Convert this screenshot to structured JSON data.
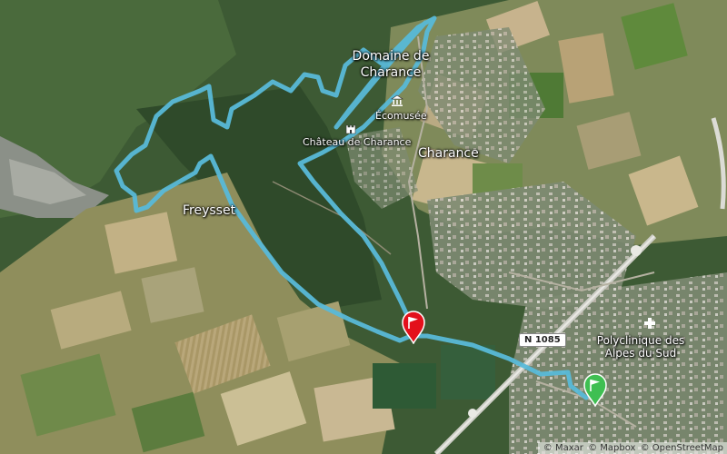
{
  "map": {
    "labels": {
      "domaine": "Domaine de Charance",
      "ecomusee": "Écomusée",
      "chateau": "Château de Charance",
      "charance": "Charance",
      "freysset": "Freysset",
      "polyclinique": "Polyclinique des Alpes du Sud",
      "road": "N 1085"
    },
    "icons": {
      "start": "red-flag-marker",
      "finish": "green-flag-marker",
      "museum": "museum-icon",
      "castle": "castle-icon",
      "hospital": "hospital-icon"
    },
    "route_color": "#58b9d8",
    "start_color": "#e3101b",
    "finish_color": "#3fbf52",
    "attribution": {
      "mapbox_logo": "Mapbox",
      "items": [
        "© Maxar",
        "© Mapbox",
        "© OpenStreetMap"
      ]
    }
  }
}
